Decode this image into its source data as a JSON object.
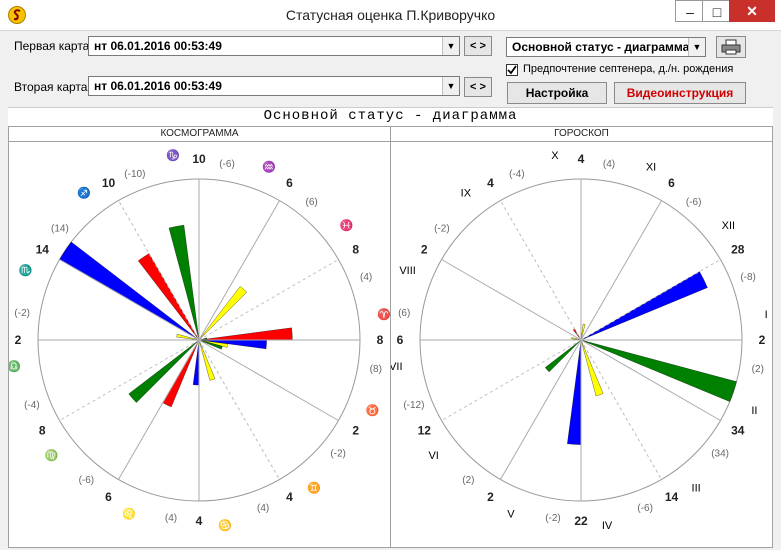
{
  "window": {
    "title": "Статусная оценка П.Криворучко",
    "minimize": "‒",
    "maximize": "□",
    "close": "✕"
  },
  "controls": {
    "first_chart_label": "Первая карта",
    "first_chart_value": "нт 06.01.2016 00:53:49",
    "second_chart_label": "Вторая карта",
    "second_chart_value": "нт 06.01.2016 00:53:49",
    "nav_label": "< >",
    "mode_value": "Основной статус - диаграмма",
    "checkbox_label": "Предпочтение септенера, д./н. рождения",
    "checkbox_checked": true,
    "settings_button": "Настройка",
    "video_button": "Видеоинструкция",
    "video_color": "#d00000"
  },
  "diagram": {
    "title": "Основной статус - диаграмма",
    "colors": {
      "yellow": "#ffff00",
      "blue": "#0000ff",
      "red": "#ff0000",
      "green": "#008000"
    },
    "cosmogram": {
      "heading": "КОСМОГРАММА",
      "sectors": [
        {
          "symbol": "♈",
          "value": "8",
          "sub": "(8)",
          "slices": {
            "yellow": 0.18,
            "blue": 0.42,
            "red": 0.58,
            "green": 0.05
          }
        },
        {
          "symbol": "♓",
          "value": "8",
          "sub": "(4)",
          "slices": {
            "yellow": 0.0,
            "blue": 0.0,
            "red": 0.0,
            "green": 0.0
          }
        },
        {
          "symbol": "♒",
          "value": "6",
          "sub": "(6)",
          "slices": {
            "yellow": 0.42,
            "blue": 0.0,
            "red": 0.0,
            "green": 0.0
          }
        },
        {
          "symbol": "♑",
          "value": "10",
          "sub": "(-6)",
          "slices": {
            "yellow": 0.0,
            "blue": 0.0,
            "red": 0.0,
            "green": 0.72
          }
        },
        {
          "symbol": "♐",
          "value": "10",
          "sub": "(-10)",
          "slices": {
            "yellow": 0.0,
            "blue": 0.0,
            "red": 0.62,
            "green": 0.0
          }
        },
        {
          "symbol": "♏",
          "value": "14",
          "sub": "(14)",
          "slices": {
            "yellow": 0.0,
            "blue": 1.0,
            "red": 0.0,
            "green": 0.0
          }
        },
        {
          "symbol": "♎",
          "value": "2",
          "sub": "(-2)",
          "slices": {
            "yellow": 0.14,
            "blue": 0.0,
            "red": 0.0,
            "green": 0.0
          }
        },
        {
          "symbol": "♍",
          "value": "8",
          "sub": "(-4)",
          "slices": {
            "yellow": 0.0,
            "blue": 0.0,
            "red": 0.0,
            "green": 0.55
          }
        },
        {
          "symbol": "♌",
          "value": "6",
          "sub": "(-6)",
          "slices": {
            "yellow": 0.0,
            "blue": 0.0,
            "red": 0.45,
            "green": 0.0
          }
        },
        {
          "symbol": "♋",
          "value": "4",
          "sub": "(4)",
          "slices": {
            "yellow": 0.0,
            "blue": 0.28,
            "red": 0.0,
            "green": 0.0
          }
        },
        {
          "symbol": "♊",
          "value": "4",
          "sub": "(4)",
          "slices": {
            "yellow": 0.26,
            "blue": 0.0,
            "red": 0.0,
            "green": 0.0
          }
        },
        {
          "symbol": "♉",
          "value": "2",
          "sub": "(-2)",
          "slices": {
            "yellow": 0.0,
            "blue": 0.0,
            "red": 0.0,
            "green": 0.15
          }
        }
      ]
    },
    "horoscope": {
      "heading": "ГОРОСКОП",
      "sectors": [
        {
          "symbol": "I",
          "value": "2",
          "sub": "(2)",
          "slices": {
            "yellow": 0.0,
            "blue": 0.0,
            "red": 0.0,
            "green": 0.0
          }
        },
        {
          "symbol": "XII",
          "value": "28",
          "sub": "(-8)",
          "slices": {
            "yellow": 0.0,
            "blue": 0.85,
            "red": 0.0,
            "green": 0.0
          }
        },
        {
          "symbol": "XI",
          "value": "6",
          "sub": "(-6)",
          "slices": {
            "yellow": 0.0,
            "blue": 0.0,
            "red": 0.0,
            "green": 0.0
          }
        },
        {
          "symbol": "X",
          "value": "4",
          "sub": "(4)",
          "slices": {
            "yellow": 0.1,
            "blue": 0.0,
            "red": 0.0,
            "green": 0.0
          }
        },
        {
          "symbol": "IX",
          "value": "4",
          "sub": "(-4)",
          "slices": {
            "yellow": 0.0,
            "blue": 0.0,
            "red": 0.08,
            "green": 0.0
          }
        },
        {
          "symbol": "VIII",
          "value": "2",
          "sub": "(-2)",
          "slices": {
            "yellow": 0.0,
            "blue": 0.0,
            "red": 0.0,
            "green": 0.0
          }
        },
        {
          "symbol": "VII",
          "value": "6",
          "sub": "(6)",
          "slices": {
            "yellow": 0.06,
            "blue": 0.0,
            "red": 0.0,
            "green": 0.0
          }
        },
        {
          "symbol": "VI",
          "value": "12",
          "sub": "(-12)",
          "slices": {
            "yellow": 0.0,
            "blue": 0.0,
            "red": 0.0,
            "green": 0.28
          }
        },
        {
          "symbol": "V",
          "value": "2",
          "sub": "(2)",
          "slices": {
            "yellow": 0.0,
            "blue": 0.0,
            "red": 0.0,
            "green": 0.0
          }
        },
        {
          "symbol": "IV",
          "value": "22",
          "sub": "(-2)",
          "slices": {
            "yellow": 0.0,
            "blue": 0.65,
            "red": 0.0,
            "green": 0.0
          }
        },
        {
          "symbol": "III",
          "value": "14",
          "sub": "(-6)",
          "slices": {
            "yellow": 0.36,
            "blue": 0.0,
            "red": 0.0,
            "green": 0.0
          }
        },
        {
          "symbol": "II",
          "value": "34",
          "sub": "(34)",
          "slices": {
            "yellow": 0.0,
            "blue": 0.0,
            "red": 0.0,
            "green": 1.0
          }
        }
      ]
    }
  }
}
